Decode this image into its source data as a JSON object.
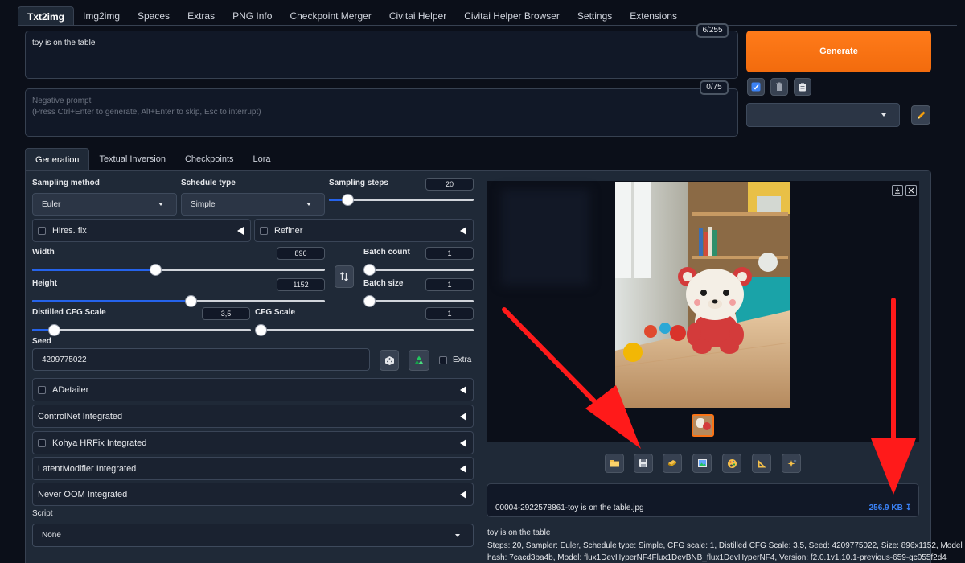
{
  "nav": {
    "tabs": [
      "Txt2img",
      "Img2img",
      "Spaces",
      "Extras",
      "PNG Info",
      "Checkpoint Merger",
      "Civitai Helper",
      "Civitai Helper Browser",
      "Settings",
      "Extensions"
    ],
    "active": 0
  },
  "prompt": {
    "value": "toy is on the table",
    "counter": "6/255"
  },
  "negative": {
    "placeholder_line1": "Negative prompt",
    "placeholder_line2": "(Press Ctrl+Enter to generate, Alt+Enter to skip, Esc to interrupt)",
    "counter": "0/75"
  },
  "generate_label": "Generate",
  "subtabs": [
    "Generation",
    "Textual Inversion",
    "Checkpoints",
    "Lora"
  ],
  "params": {
    "sampling_method_label": "Sampling method",
    "sampling_method": "Euler",
    "schedule_type_label": "Schedule type",
    "schedule_type": "Simple",
    "sampling_steps_label": "Sampling steps",
    "sampling_steps": "20",
    "sampling_steps_level": 0.13,
    "hires_label": "Hires. fix",
    "refiner_label": "Refiner",
    "width_label": "Width",
    "width": "896",
    "width_level": 0.42,
    "height_label": "Height",
    "height": "1152",
    "height_level": 0.54,
    "batch_count_label": "Batch count",
    "batch_count": "1",
    "batch_size_label": "Batch size",
    "batch_size": "1",
    "distilled_cfg_label": "Distilled CFG Scale",
    "distilled_cfg": "3,5",
    "distilled_cfg_level": 0.1,
    "cfg_label": "CFG Scale",
    "cfg": "1",
    "seed_label": "Seed",
    "seed": "4209775022",
    "extra_label": "Extra"
  },
  "accordions": [
    {
      "label": "ADetailer",
      "checkbox": true
    },
    {
      "label": "ControlNet Integrated",
      "checkbox": false
    },
    {
      "label": "Kohya HRFix Integrated",
      "checkbox": true
    },
    {
      "label": "LatentModifier Integrated",
      "checkbox": false
    },
    {
      "label": "Never OOM Integrated",
      "checkbox": false
    }
  ],
  "script": {
    "label": "Script",
    "value": "None"
  },
  "output": {
    "filename": "00004-2922578861-toy is on the table.jpg",
    "filesize": "256.9 KB",
    "info_prompt": "toy is on the table",
    "info_line1": "Steps: 20, Sampler: Euler, Schedule type: Simple, CFG scale: 1, Distilled CFG Scale: 3.5, Seed: 4209775022, Size: 896x1152, Model",
    "info_line2": "hash: 7cacd3ba4b, Model: flux1DevHyperNF4Flux1DevBNB_flux1DevHyperNF4, Version: f2.0.1v1.10.1-previous-659-gc055f2d4"
  },
  "colors": {
    "background": "#0b0f19",
    "panel": "#1f2937",
    "accent_orange": "#f97316",
    "slider_blue": "#2563eb",
    "arrow_red": "#ff1a1a",
    "link_blue": "#3b82f6"
  }
}
